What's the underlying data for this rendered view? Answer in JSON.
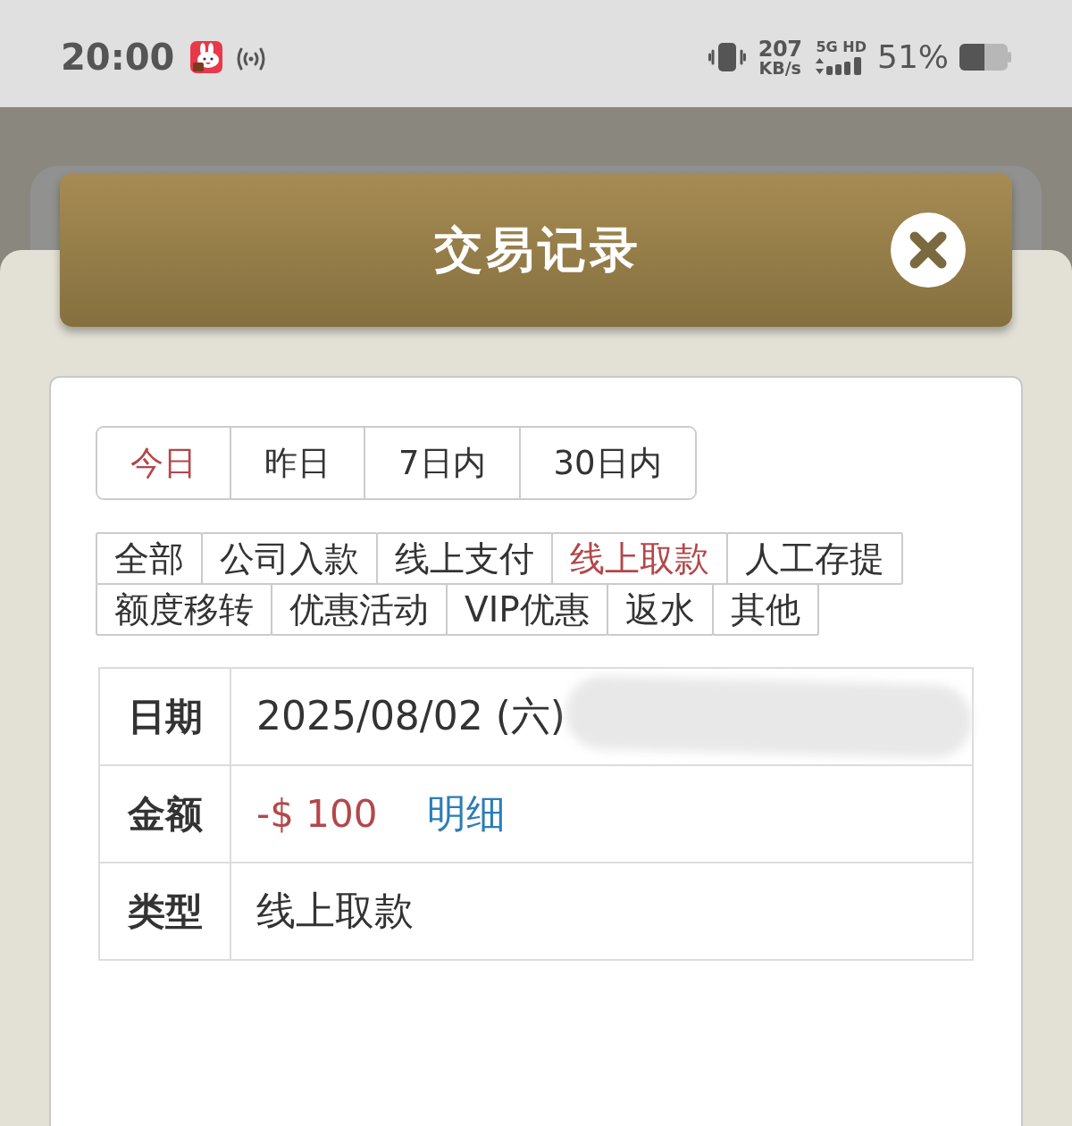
{
  "status_bar": {
    "time": "20:00",
    "speed": "207",
    "speed_unit": "KB/s",
    "network": "5G HD",
    "battery": "51%"
  },
  "dialog": {
    "title": "交易记录",
    "date_tabs": [
      {
        "label": "今日",
        "selected": true
      },
      {
        "label": "昨日",
        "selected": false
      },
      {
        "label": "7日内",
        "selected": false
      },
      {
        "label": "30日内",
        "selected": false
      }
    ],
    "type_filters": [
      {
        "label": "全部",
        "selected": false
      },
      {
        "label": "公司入款",
        "selected": false
      },
      {
        "label": "线上支付",
        "selected": false
      },
      {
        "label": "线上取款",
        "selected": true
      },
      {
        "label": "人工存提",
        "selected": false
      },
      {
        "label": "额度移转",
        "selected": false
      },
      {
        "label": "优惠活动",
        "selected": false
      },
      {
        "label": "VIP优惠",
        "selected": false
      },
      {
        "label": "返水",
        "selected": false
      },
      {
        "label": "其他",
        "selected": false
      }
    ],
    "details": [
      {
        "kind": "text",
        "label": "日期",
        "value": "2025/08/02 (六)",
        "blurred": true
      },
      {
        "kind": "amount",
        "label": "金额",
        "value": "-$ 100",
        "link": "明细",
        "blurred": false
      },
      {
        "kind": "text",
        "label": "类型",
        "value": "线上取款",
        "blurred": false
      }
    ]
  }
}
